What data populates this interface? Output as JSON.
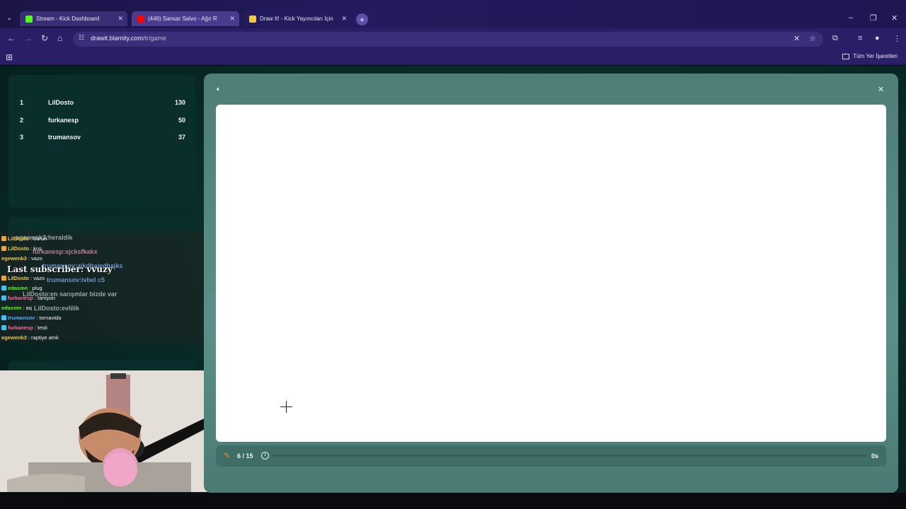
{
  "browser": {
    "tabs": [
      {
        "title": "Stream - Kick Dashboard",
        "favicon_color": "#53fc18"
      },
      {
        "title": "(446) Sansar Salvo - Ağır R",
        "favicon_color": "#ff0000"
      },
      {
        "title": "Draw It! - Kick Yayıncıları İçin",
        "favicon_color": "#f2c94c"
      }
    ],
    "url_host": "drawit.blamity.com",
    "url_path": "/tr/game",
    "bookmarks_all_label": "Tüm Yer İşaretleri"
  },
  "leaderboard": [
    {
      "rank": "1",
      "name": "LilDosto",
      "score": "130"
    },
    {
      "rank": "2",
      "name": "furkanesp",
      "score": "50"
    },
    {
      "rank": "3",
      "name": "trumansov",
      "score": "37"
    }
  ],
  "chat": {
    "lines": [
      {
        "user": "LilDosto",
        "text": ": burun",
        "color": "#f2c94c"
      },
      {
        "user": "LilDosto",
        "text": ": kus",
        "color": "#f2c94c"
      },
      {
        "user": "egewenk3",
        "text": ": vazo",
        "color": "#f2c94c"
      },
      {
        "user": "LilDosto",
        "text": ": vazo",
        "color": "#f2c94c"
      },
      {
        "user": "edasmn",
        "text": ": plug",
        "color": "#53fc18"
      },
      {
        "user": "furkanesp",
        "text": ": tampon",
        "color": "#ff6b9a"
      },
      {
        "user": "edasmn",
        "text": ": aq",
        "color": "#53fc18"
      },
      {
        "user": "trumansov",
        "text": ": tornavida",
        "color": "#5aa9ff"
      },
      {
        "user": "furkanesp",
        "text": ": testi",
        "color": "#ff6b9a"
      },
      {
        "user": "egewenk3",
        "text": ": raptiye amk",
        "color": "#f2c94c"
      }
    ],
    "ghost_lines": [
      "egewenk3:heraldik",
      "furkanesp:sjcksfkakx",
      "trumansov:aikdhaiedhajks",
      "trumansov:ivbel c5",
      "LilDosto:en sarışmlar bizde var",
      "LilDosto:evlilik"
    ],
    "last_subscriber": "Last subscriber: vvuzy"
  },
  "game": {
    "round": "6 / 15",
    "seconds": "0s",
    "progress": 0.0
  },
  "icons": {
    "sound": "speaker-icon",
    "close": "close-icon",
    "pencil": "pencil-icon",
    "timer": "timer-icon"
  }
}
